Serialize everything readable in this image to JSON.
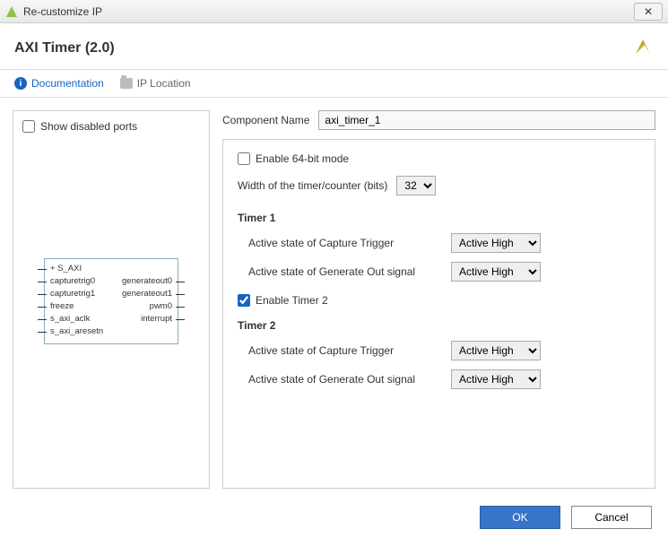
{
  "window": {
    "title": "Re-customize IP",
    "close": "✕"
  },
  "header": {
    "title": "AXI Timer (2.0)"
  },
  "toolbar": {
    "documentation": "Documentation",
    "ip_location": "IP Location"
  },
  "left": {
    "show_disabled_ports": "Show disabled ports",
    "block": {
      "left_ports": [
        "+ S_AXI",
        "capturetrig0",
        "capturetrig1",
        "freeze",
        "s_axi_aclk",
        "s_axi_aresetn"
      ],
      "right_ports": [
        "",
        "generateout0",
        "generateout1",
        "pwm0",
        "interrupt",
        ""
      ]
    }
  },
  "right": {
    "component_name_label": "Component Name",
    "component_name_value": "axi_timer_1",
    "enable_64bit": "Enable 64-bit mode",
    "width_label": "Width of the timer/counter (bits)",
    "width_value": "32",
    "timer1_title": "Timer 1",
    "timer2_title": "Timer 2",
    "capture_trigger_label": "Active state of Capture Trigger",
    "generate_out_label": "Active state of Generate Out signal",
    "timer1_capture": "Active High",
    "timer1_generate": "Active High",
    "enable_timer2_label": "Enable Timer 2",
    "timer2_capture": "Active High",
    "timer2_generate": "Active High"
  },
  "footer": {
    "ok": "OK",
    "cancel": "Cancel"
  }
}
